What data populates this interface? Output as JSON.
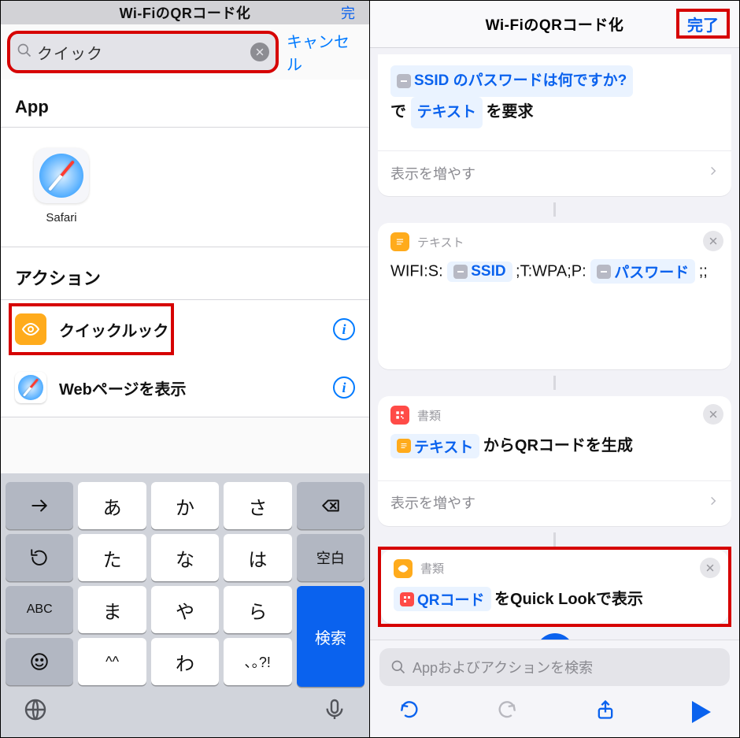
{
  "left": {
    "topTitle": "Wi-FiのQRコード化",
    "topDoneFragment": "完",
    "search": {
      "value": "クイック",
      "placeholder": ""
    },
    "cancel": "キャンセル",
    "appHeader": "App",
    "apps": [
      {
        "label": "Safari"
      }
    ],
    "actionHeader": "アクション",
    "actions": [
      {
        "label": "クイックルック"
      },
      {
        "label": "Webページを表示"
      }
    ],
    "keyboard": {
      "rows": [
        [
          "→",
          "あ",
          "か",
          "さ",
          "⌫"
        ],
        [
          "↺",
          "た",
          "な",
          "は",
          "空白"
        ],
        [
          "ABC",
          "ま",
          "や",
          "ら",
          "検索"
        ],
        [
          "☺",
          "^^",
          "わ",
          "､｡?!",
          ""
        ]
      ]
    }
  },
  "right": {
    "title": "Wi-FiのQRコード化",
    "done": "完了",
    "card1": {
      "chipText": "SSID のパスワードは何ですか?",
      "line2_pre": "で ",
      "line2_chip": "テキスト",
      "line2_post": " を要求",
      "showMore": "表示を増やす"
    },
    "card2": {
      "head": "テキスト",
      "body_pre": "WIFI:S: ",
      "chip1": "SSID",
      "body_mid": " ;T:WPA;P: ",
      "chip2": "パスワード",
      "body_post": " ;;"
    },
    "card3": {
      "head": "書類",
      "chip": "テキスト",
      "post": " からQRコードを生成",
      "showMore": "表示を増やす"
    },
    "card4": {
      "head": "書類",
      "chip": "QRコード",
      "post": " をQuick Lookで表示"
    },
    "bottomSearchPlaceholder": "Appおよびアクションを検索"
  }
}
